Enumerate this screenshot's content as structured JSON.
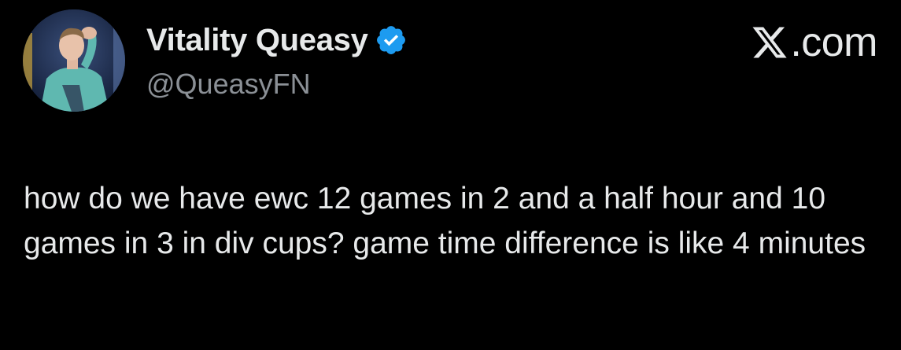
{
  "author": {
    "display_name": "Vitality Queasy",
    "handle": "@QueasyFN",
    "verified": true,
    "avatar_icon": "profile-photo",
    "badge_icon": "verified-checkmark-icon",
    "badge_color": "#1d9bf0"
  },
  "brand": {
    "logo_icon": "x-logo-icon",
    "logo_text": ".com"
  },
  "tweet": {
    "text": "how do we have ewc 12 games in 2 and a half hour and 10 games in 3 in div cups? game time difference is like 4 minutes"
  },
  "colors": {
    "background": "#000000",
    "text_primary": "#e7e9ea",
    "text_secondary": "#8b9096",
    "accent": "#1d9bf0"
  }
}
